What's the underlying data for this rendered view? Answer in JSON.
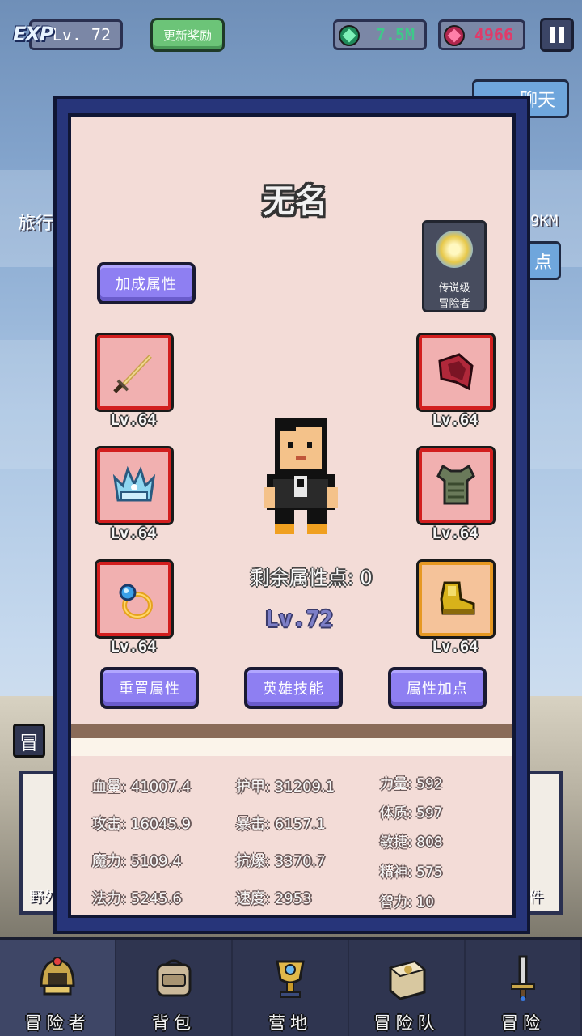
{
  "topbar": {
    "exp_logo": "EXP",
    "level": "Lv. 72",
    "update_reward_label": "更新奖励",
    "green_currency": "7.5M",
    "red_currency": "4966",
    "green_color": "#2fbf7a",
    "red_color": "#e03a6a"
  },
  "background": {
    "chat_button": "聊天",
    "travel_text": "旅行",
    "distance_text": "9KM",
    "side_btn_text": "点",
    "adventure_tab_icon": "冒",
    "left_card_text": "野外",
    "right_card_text": "件"
  },
  "hero": {
    "name": "无名",
    "bonus_attr_label": "加成属性",
    "rank_line1": "传说级",
    "rank_line2": "冒险者",
    "remaining_points": "剩余属性点: 0",
    "level": "Lv.72",
    "equipment": [
      {
        "slot": "weapon",
        "icon": "sword-icon",
        "level": "Lv.64"
      },
      {
        "slot": "helmet",
        "icon": "crown-helmet-icon",
        "level": "Lv.64"
      },
      {
        "slot": "ring",
        "icon": "ring-icon",
        "level": "Lv.64"
      },
      {
        "slot": "shield",
        "icon": "shield-icon",
        "level": "Lv.64"
      },
      {
        "slot": "armor",
        "icon": "armor-icon",
        "level": "Lv.64"
      },
      {
        "slot": "boots",
        "icon": "boots-icon",
        "level": "Lv.64"
      }
    ],
    "buttons": {
      "reset": "重置属性",
      "skills": "英雄技能",
      "allocate": "属性加点"
    }
  },
  "stats": {
    "hp": "血量: 41007.4",
    "attack": "攻击: 16045.9",
    "magic_power": "魔力: 5109.4",
    "mana": "法力: 5245.6",
    "armor": "护甲: 31209.1",
    "crit": "暴击: 6157.1",
    "crit_resist": "抗爆: 3370.7",
    "speed": "速度: 2953",
    "strength": "力量: 592",
    "constitution": "体质: 597",
    "agility": "敏捷: 808",
    "spirit": "精神: 575",
    "intelligence": "智力: 10"
  },
  "nav": {
    "items": [
      {
        "label": "冒险者",
        "icon": "helmet-icon"
      },
      {
        "label": "背包",
        "icon": "backpack-icon"
      },
      {
        "label": "营地",
        "icon": "trophy-icon"
      },
      {
        "label": "冒险队",
        "icon": "book-icon"
      },
      {
        "label": "冒险",
        "icon": "sword-icon"
      }
    ]
  }
}
